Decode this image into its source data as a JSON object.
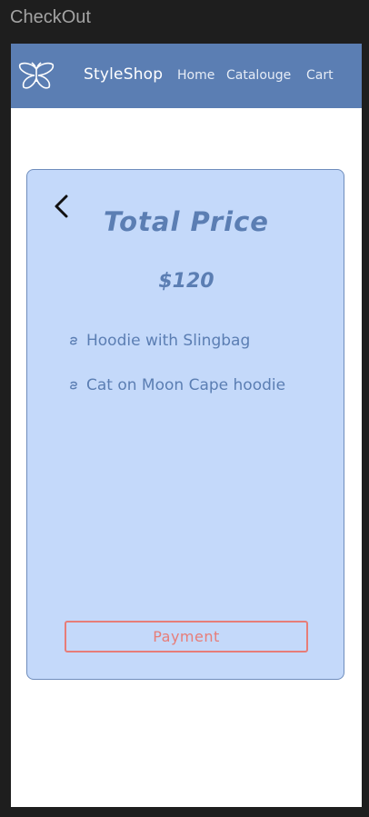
{
  "frame": {
    "title": "CheckOut"
  },
  "navbar": {
    "logo_icon": "butterfly-icon",
    "brand": "StyleShop",
    "links": [
      "Home",
      "Catalouge",
      "Cart"
    ]
  },
  "checkout": {
    "back_icon": "chevron-left-icon",
    "title": "Total Price",
    "price": "$120",
    "items": [
      {
        "icon": "item-bullet-icon",
        "label": "Hoodie with Slingbag"
      },
      {
        "icon": "item-bullet-icon",
        "label": "Cat on Moon Cape hoodie"
      }
    ],
    "payment_label": "Payment"
  },
  "colors": {
    "navbar": "#5b7eb3",
    "card_bg": "#c4d9fa",
    "accent_text": "#5b7eb3",
    "payment": "#e77d78",
    "canvas_bg": "#1e1e1e"
  }
}
